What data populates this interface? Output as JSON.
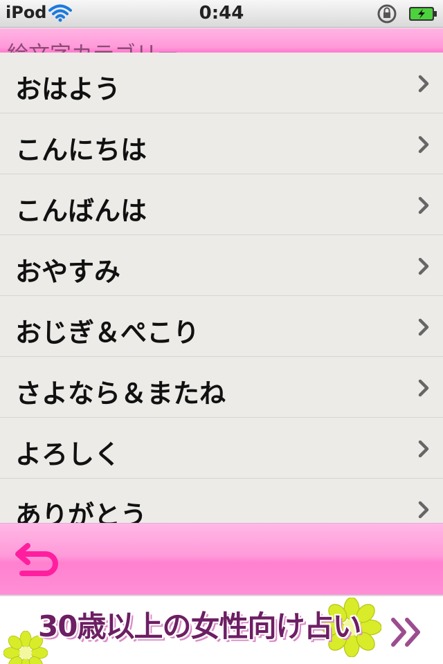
{
  "status_bar": {
    "carrier": "iPod",
    "time": "0:44"
  },
  "nav": {
    "title": "絵文字カテゴリー"
  },
  "list": {
    "items": [
      {
        "label": "おはよう"
      },
      {
        "label": "こんにちは"
      },
      {
        "label": "こんばんは"
      },
      {
        "label": "おやすみ"
      },
      {
        "label": "おじぎ＆ぺこり"
      },
      {
        "label": "さよなら＆またね"
      },
      {
        "label": "よろしく"
      },
      {
        "label": "ありがとう"
      }
    ]
  },
  "toolbar": {
    "back_icon": "return-arrow-icon"
  },
  "ad": {
    "text": "30歳以上の女性向け占い"
  },
  "colors": {
    "accent_pink": "#ff8fd6",
    "back_arrow": "#ff1f9e",
    "list_bg": "#ecebe8"
  }
}
